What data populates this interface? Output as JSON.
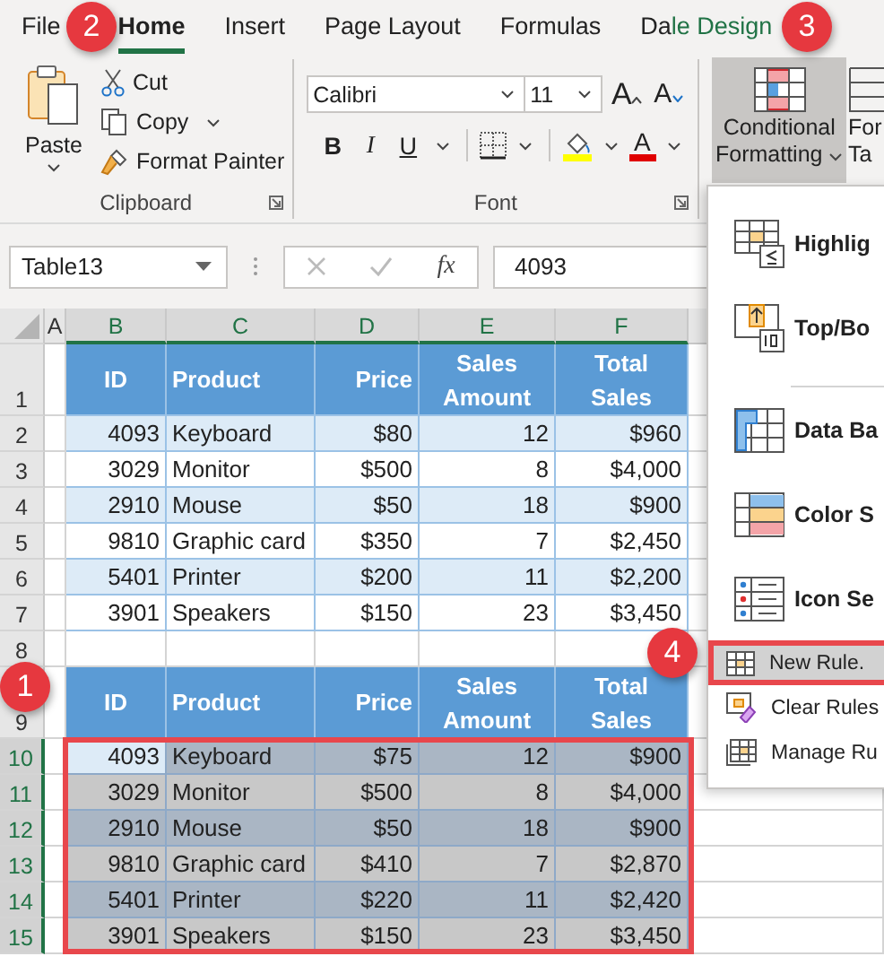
{
  "tabs": [
    {
      "label": "File",
      "selected": false,
      "contextual": false
    },
    {
      "label": "Home",
      "selected": true,
      "contextual": false
    },
    {
      "label": "Insert",
      "selected": false,
      "contextual": false
    },
    {
      "label": "Page Layout",
      "selected": false,
      "contextual": false
    },
    {
      "label": "Formulas",
      "selected": false,
      "contextual": false
    },
    {
      "label": "Da",
      "selected": false,
      "contextual": false
    },
    {
      "label": "le Design",
      "selected": false,
      "contextual": true
    }
  ],
  "ribbon": {
    "groups": [
      {
        "kind": "clipboard",
        "label": "Clipboard",
        "paste": "Paste",
        "cut": "Cut",
        "copy": "Copy",
        "format_painter": "Format Painter"
      },
      {
        "kind": "font",
        "label": "Font",
        "font_name": "Calibri",
        "font_size": "11",
        "grow": "A",
        "shrink": "A",
        "bold": "B",
        "italic": "I",
        "underline": "U",
        "font_color": "A"
      },
      {
        "kind": "conditional",
        "line1": "Conditional",
        "line2": "Formatting",
        "selected": true
      },
      {
        "kind": "table",
        "line1": "For",
        "line2": "Ta",
        "selected": false
      }
    ]
  },
  "formula_bar": {
    "name_box": "Table13",
    "fx": "fx",
    "value": "4093"
  },
  "sheet": {
    "columns": [
      {
        "label": "A",
        "selected": false
      },
      {
        "label": "B",
        "selected": true
      },
      {
        "label": "C",
        "selected": true
      },
      {
        "label": "D",
        "selected": true
      },
      {
        "label": "E",
        "selected": true
      },
      {
        "label": "F",
        "selected": true
      }
    ],
    "rows": [
      {
        "num": "1",
        "kind": "header",
        "selected": false,
        "active": false,
        "cells": [
          "ID",
          "Product",
          "Price",
          "Sales Amount",
          "Total Sales"
        ]
      },
      {
        "num": "2",
        "kind": "data",
        "selected": false,
        "active": false,
        "cells": [
          "4093",
          "Keyboard",
          "$80",
          "12",
          "$960"
        ]
      },
      {
        "num": "3",
        "kind": "data",
        "selected": false,
        "active": false,
        "cells": [
          "3029",
          "Monitor",
          "$500",
          "8",
          "$4,000"
        ]
      },
      {
        "num": "4",
        "kind": "data",
        "selected": false,
        "active": false,
        "cells": [
          "2910",
          "Mouse",
          "$50",
          "18",
          "$900"
        ]
      },
      {
        "num": "5",
        "kind": "data",
        "selected": false,
        "active": false,
        "cells": [
          "9810",
          "Graphic card",
          "$350",
          "7",
          "$2,450"
        ]
      },
      {
        "num": "6",
        "kind": "data",
        "selected": false,
        "active": false,
        "cells": [
          "5401",
          "Printer",
          "$200",
          "11",
          "$2,200"
        ]
      },
      {
        "num": "7",
        "kind": "data",
        "selected": false,
        "active": false,
        "cells": [
          "3901",
          "Speakers",
          "$150",
          "23",
          "$3,450"
        ]
      },
      {
        "num": "8",
        "kind": "blank",
        "selected": false,
        "active": false
      },
      {
        "num": "9",
        "kind": "header",
        "selected": false,
        "active": false,
        "cells": [
          "ID",
          "Product",
          "Price",
          "Sales Amount",
          "Total Sales"
        ]
      },
      {
        "num": "10",
        "kind": "data",
        "selected": true,
        "active": true,
        "cells": [
          "4093",
          "Keyboard",
          "$75",
          "12",
          "$900"
        ]
      },
      {
        "num": "11",
        "kind": "data",
        "selected": true,
        "active": false,
        "cells": [
          "3029",
          "Monitor",
          "$500",
          "8",
          "$4,000"
        ]
      },
      {
        "num": "12",
        "kind": "data",
        "selected": true,
        "active": false,
        "cells": [
          "2910",
          "Mouse",
          "$50",
          "18",
          "$900"
        ]
      },
      {
        "num": "13",
        "kind": "data",
        "selected": true,
        "active": false,
        "cells": [
          "9810",
          "Graphic card",
          "$410",
          "7",
          "$2,870"
        ]
      },
      {
        "num": "14",
        "kind": "data",
        "selected": true,
        "active": false,
        "cells": [
          "5401",
          "Printer",
          "$220",
          "11",
          "$2,420"
        ]
      },
      {
        "num": "15",
        "kind": "data",
        "selected": true,
        "active": false,
        "cells": [
          "3901",
          "Speakers",
          "$150",
          "23",
          "$3,450"
        ]
      }
    ]
  },
  "menu": {
    "items": [
      {
        "label": "Highlig",
        "kind": "highlight",
        "selected": false,
        "divider_after": false
      },
      {
        "label": "Top/Bo",
        "kind": "topbottom",
        "selected": false,
        "divider_after": true
      },
      {
        "label": "Data Ba",
        "kind": "databars",
        "selected": false,
        "divider_after": false
      },
      {
        "label": "Color S",
        "kind": "colorscales",
        "selected": false,
        "divider_after": false
      },
      {
        "label": "Icon Se",
        "kind": "iconsets",
        "selected": false,
        "divider_after": false
      },
      {
        "label": "New Rule.",
        "kind": "newrule",
        "selected": true,
        "divider_after": false
      },
      {
        "label": "Clear Rules",
        "kind": "clearrules",
        "selected": false,
        "divider_after": false
      },
      {
        "label": "Manage Ru",
        "kind": "managerules",
        "selected": false,
        "divider_after": false
      }
    ]
  },
  "callouts": [
    "1",
    "2",
    "3",
    "4"
  ]
}
